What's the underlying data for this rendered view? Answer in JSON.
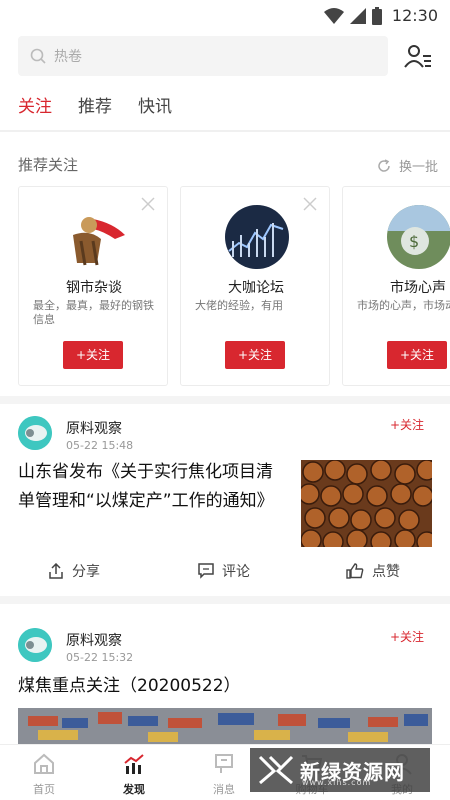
{
  "status_bar": {
    "time": "12:30"
  },
  "search": {
    "placeholder": "热卷"
  },
  "tabs": [
    {
      "label": "关注",
      "active": true
    },
    {
      "label": "推荐",
      "active": false
    },
    {
      "label": "快讯",
      "active": false
    }
  ],
  "recommend": {
    "title": "推荐关注",
    "refresh_label": "换一批",
    "cards": [
      {
        "name": "钢市杂谈",
        "desc": "最全，最真，最好的钢铁信息",
        "follow": "+关注"
      },
      {
        "name": "大咖论坛",
        "desc": "大佬的经验，有用",
        "follow": "+关注"
      },
      {
        "name": "市场心声",
        "desc": "市场的心声，市场动态",
        "follow": "+关注"
      }
    ]
  },
  "articles": [
    {
      "author": "原料观察",
      "time": "05-22 15:48",
      "follow": "+关注",
      "title_line1": "山东省发布《关于实行焦化项目清",
      "title_line2": "单管理和“以煤定产”工作的通知》",
      "actions": {
        "share": "分享",
        "comment": "评论",
        "like": "点赞"
      }
    },
    {
      "author": "原料观察",
      "time": "05-22 15:32",
      "follow": "+关注",
      "title_line1": "煤焦重点关注（20200522）"
    }
  ],
  "bottom_nav": [
    {
      "label": "首页",
      "icon": "home-icon",
      "active": false
    },
    {
      "label": "发现",
      "icon": "chart-icon",
      "active": true
    },
    {
      "label": "消息",
      "icon": "message-icon",
      "active": false
    },
    {
      "label": "购物车",
      "icon": "cart-icon",
      "active": false
    },
    {
      "label": "我的",
      "icon": "user-icon",
      "active": false
    }
  ],
  "watermark": {
    "text": "新绿资源网",
    "sub": "www.xlhs.com"
  },
  "colors": {
    "accent": "#d8272f",
    "separator": "#f4f4f4"
  }
}
